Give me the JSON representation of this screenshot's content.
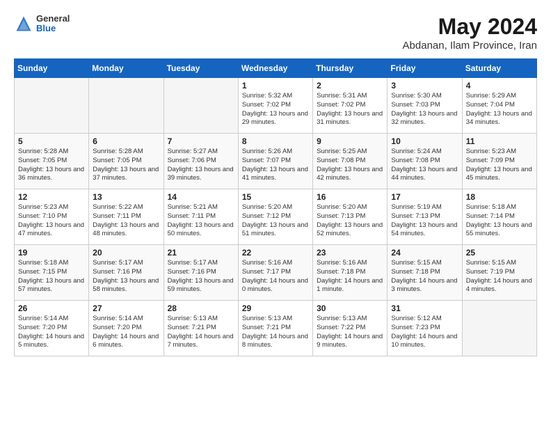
{
  "header": {
    "logo_general": "General",
    "logo_blue": "Blue",
    "month_year": "May 2024",
    "location": "Abdanan, Ilam Province, Iran"
  },
  "weekdays": [
    "Sunday",
    "Monday",
    "Tuesday",
    "Wednesday",
    "Thursday",
    "Friday",
    "Saturday"
  ],
  "weeks": [
    [
      {
        "day": "",
        "empty": true
      },
      {
        "day": "",
        "empty": true
      },
      {
        "day": "",
        "empty": true
      },
      {
        "day": "1",
        "sunrise": "5:32 AM",
        "sunset": "7:02 PM",
        "daylight": "13 hours and 29 minutes."
      },
      {
        "day": "2",
        "sunrise": "5:31 AM",
        "sunset": "7:02 PM",
        "daylight": "13 hours and 31 minutes."
      },
      {
        "day": "3",
        "sunrise": "5:30 AM",
        "sunset": "7:03 PM",
        "daylight": "13 hours and 32 minutes."
      },
      {
        "day": "4",
        "sunrise": "5:29 AM",
        "sunset": "7:04 PM",
        "daylight": "13 hours and 34 minutes."
      }
    ],
    [
      {
        "day": "5",
        "sunrise": "5:28 AM",
        "sunset": "7:05 PM",
        "daylight": "13 hours and 36 minutes."
      },
      {
        "day": "6",
        "sunrise": "5:28 AM",
        "sunset": "7:05 PM",
        "daylight": "13 hours and 37 minutes."
      },
      {
        "day": "7",
        "sunrise": "5:27 AM",
        "sunset": "7:06 PM",
        "daylight": "13 hours and 39 minutes."
      },
      {
        "day": "8",
        "sunrise": "5:26 AM",
        "sunset": "7:07 PM",
        "daylight": "13 hours and 41 minutes."
      },
      {
        "day": "9",
        "sunrise": "5:25 AM",
        "sunset": "7:08 PM",
        "daylight": "13 hours and 42 minutes."
      },
      {
        "day": "10",
        "sunrise": "5:24 AM",
        "sunset": "7:08 PM",
        "daylight": "13 hours and 44 minutes."
      },
      {
        "day": "11",
        "sunrise": "5:23 AM",
        "sunset": "7:09 PM",
        "daylight": "13 hours and 45 minutes."
      }
    ],
    [
      {
        "day": "12",
        "sunrise": "5:23 AM",
        "sunset": "7:10 PM",
        "daylight": "13 hours and 47 minutes."
      },
      {
        "day": "13",
        "sunrise": "5:22 AM",
        "sunset": "7:11 PM",
        "daylight": "13 hours and 48 minutes."
      },
      {
        "day": "14",
        "sunrise": "5:21 AM",
        "sunset": "7:11 PM",
        "daylight": "13 hours and 50 minutes."
      },
      {
        "day": "15",
        "sunrise": "5:20 AM",
        "sunset": "7:12 PM",
        "daylight": "13 hours and 51 minutes."
      },
      {
        "day": "16",
        "sunrise": "5:20 AM",
        "sunset": "7:13 PM",
        "daylight": "13 hours and 52 minutes."
      },
      {
        "day": "17",
        "sunrise": "5:19 AM",
        "sunset": "7:13 PM",
        "daylight": "13 hours and 54 minutes."
      },
      {
        "day": "18",
        "sunrise": "5:18 AM",
        "sunset": "7:14 PM",
        "daylight": "13 hours and 55 minutes."
      }
    ],
    [
      {
        "day": "19",
        "sunrise": "5:18 AM",
        "sunset": "7:15 PM",
        "daylight": "13 hours and 57 minutes."
      },
      {
        "day": "20",
        "sunrise": "5:17 AM",
        "sunset": "7:16 PM",
        "daylight": "13 hours and 58 minutes."
      },
      {
        "day": "21",
        "sunrise": "5:17 AM",
        "sunset": "7:16 PM",
        "daylight": "13 hours and 59 minutes."
      },
      {
        "day": "22",
        "sunrise": "5:16 AM",
        "sunset": "7:17 PM",
        "daylight": "14 hours and 0 minutes."
      },
      {
        "day": "23",
        "sunrise": "5:16 AM",
        "sunset": "7:18 PM",
        "daylight": "14 hours and 1 minute."
      },
      {
        "day": "24",
        "sunrise": "5:15 AM",
        "sunset": "7:18 PM",
        "daylight": "14 hours and 3 minutes."
      },
      {
        "day": "25",
        "sunrise": "5:15 AM",
        "sunset": "7:19 PM",
        "daylight": "14 hours and 4 minutes."
      }
    ],
    [
      {
        "day": "26",
        "sunrise": "5:14 AM",
        "sunset": "7:20 PM",
        "daylight": "14 hours and 5 minutes."
      },
      {
        "day": "27",
        "sunrise": "5:14 AM",
        "sunset": "7:20 PM",
        "daylight": "14 hours and 6 minutes."
      },
      {
        "day": "28",
        "sunrise": "5:13 AM",
        "sunset": "7:21 PM",
        "daylight": "14 hours and 7 minutes."
      },
      {
        "day": "29",
        "sunrise": "5:13 AM",
        "sunset": "7:21 PM",
        "daylight": "14 hours and 8 minutes."
      },
      {
        "day": "30",
        "sunrise": "5:13 AM",
        "sunset": "7:22 PM",
        "daylight": "14 hours and 9 minutes."
      },
      {
        "day": "31",
        "sunrise": "5:12 AM",
        "sunset": "7:23 PM",
        "daylight": "14 hours and 10 minutes."
      },
      {
        "day": "",
        "empty": true
      }
    ]
  ]
}
